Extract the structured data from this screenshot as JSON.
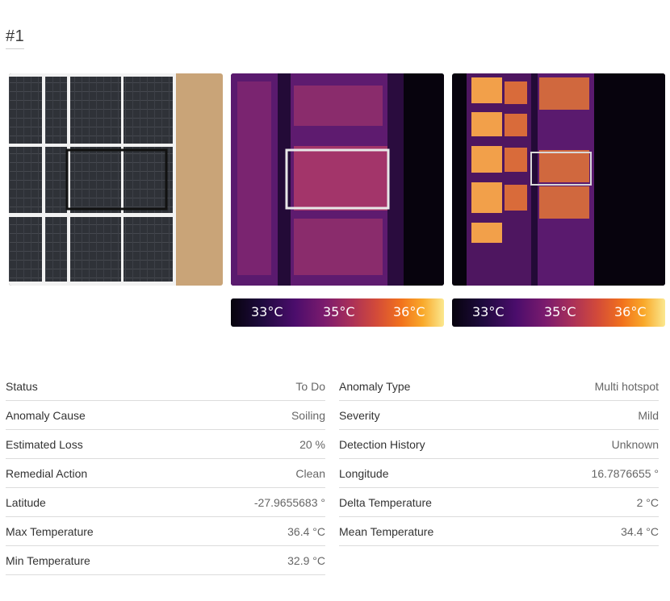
{
  "anomaly": {
    "id": "#1"
  },
  "colorbars": [
    {
      "labels": [
        "33°C",
        "35°C",
        "36°C"
      ]
    },
    {
      "labels": [
        "33°C",
        "35°C",
        "36°C"
      ]
    }
  ],
  "properties_left": [
    {
      "label": "Status",
      "value": "To Do"
    },
    {
      "label": "Anomaly Cause",
      "value": "Soiling"
    },
    {
      "label": "Estimated Loss",
      "value": "20 %"
    },
    {
      "label": "Remedial Action",
      "value": "Clean"
    },
    {
      "label": "Latitude",
      "value": "-27.9655683 °"
    },
    {
      "label": "Max Temperature",
      "value": "36.4 °C"
    },
    {
      "label": "Min Temperature",
      "value": "32.9 °C"
    }
  ],
  "properties_right": [
    {
      "label": "Anomaly Type",
      "value": "Multi hotspot"
    },
    {
      "label": "Severity",
      "value": "Mild"
    },
    {
      "label": "Detection History",
      "value": "Unknown"
    },
    {
      "label": "Longitude",
      "value": "16.7876655 °"
    },
    {
      "label": "Delta Temperature",
      "value": "2 °C"
    },
    {
      "label": "Mean Temperature",
      "value": "34.4 °C"
    }
  ]
}
